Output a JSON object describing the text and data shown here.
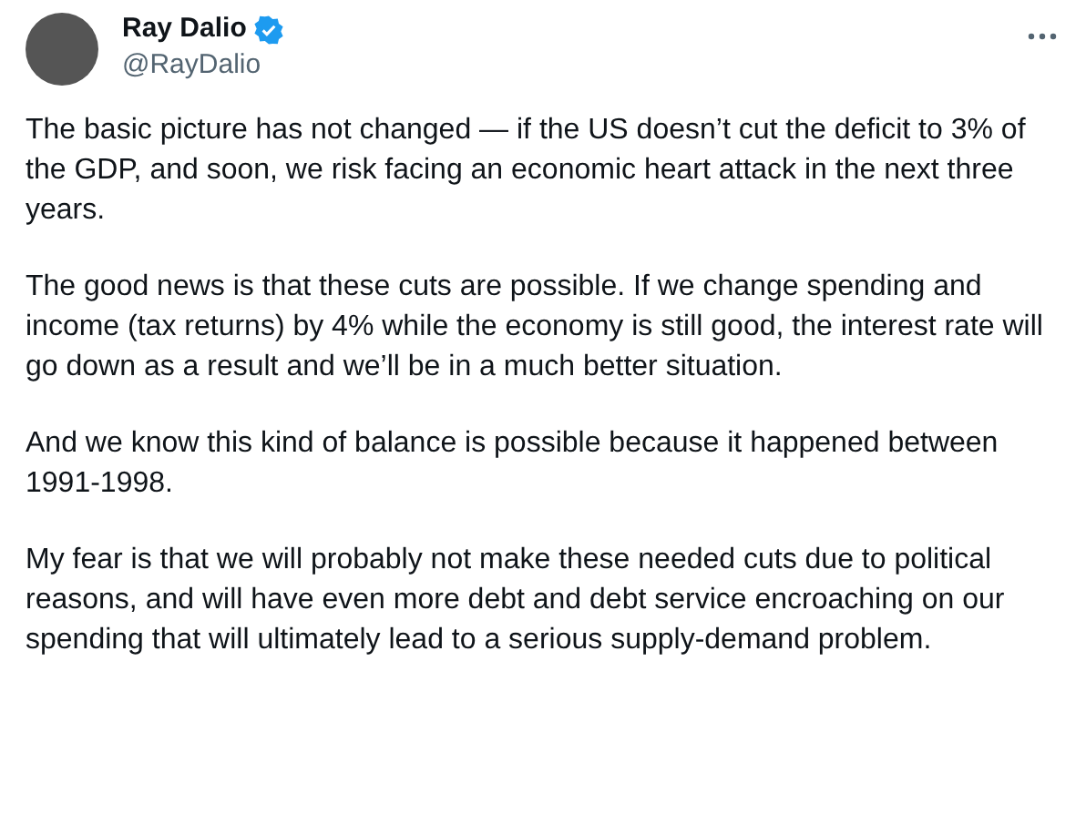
{
  "author": {
    "name": "Ray Dalio",
    "handle": "@RayDalio",
    "verified": true
  },
  "paragraphs": [
    "The basic picture has not changed — if the US doesn’t cut the deficit to 3% of the GDP, and soon, we risk facing an economic heart attack in the next three years.",
    "The good news is that these cuts are possible. If we change spending and income (tax returns) by 4% while the economy is still good, the interest rate will go down as a result and we’ll be in a much better situation.",
    "And we know this kind of balance is possible because it happened between 1991-1998.",
    "My fear is that we will probably not make these needed cuts due to political reasons, and will have even more debt and debt service encroaching on our spending that will ultimately lead to a serious supply-demand problem."
  ]
}
